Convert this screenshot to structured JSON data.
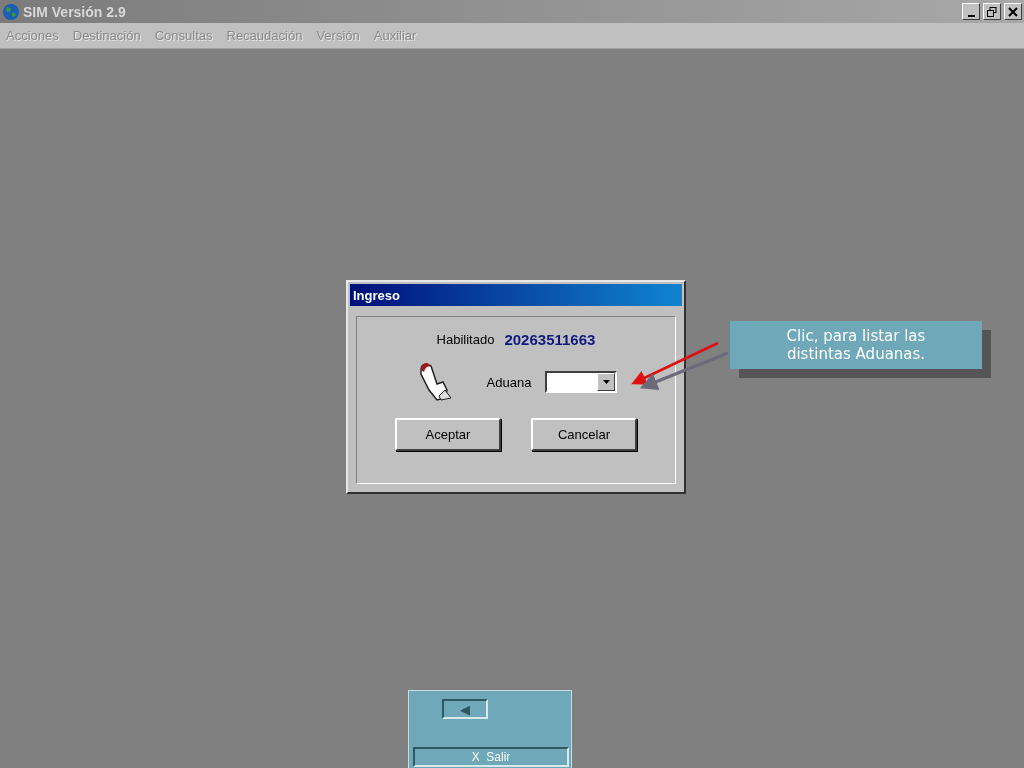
{
  "window": {
    "title": "SIM Versión 2.9"
  },
  "menu": [
    {
      "label": "Acciones",
      "disabled": true
    },
    {
      "label": "Destinación",
      "disabled": true
    },
    {
      "label": "Consultas",
      "disabled": true
    },
    {
      "label": "Recaudación",
      "disabled": true
    },
    {
      "label": "Versión",
      "disabled": true
    },
    {
      "label": "Auxiliar",
      "disabled": true
    }
  ],
  "dialog": {
    "title": "Ingreso",
    "user_label": "Habilitado",
    "user_value": "20263511663",
    "aduana_label": "Aduana",
    "buttons": [
      "Aceptar",
      "Cancelar"
    ]
  },
  "callout": {
    "text": "Clic, para listar las distintas Aduanas."
  },
  "nav_panel": {
    "back_symbol": "◀",
    "exit_label": "X  Salir"
  }
}
